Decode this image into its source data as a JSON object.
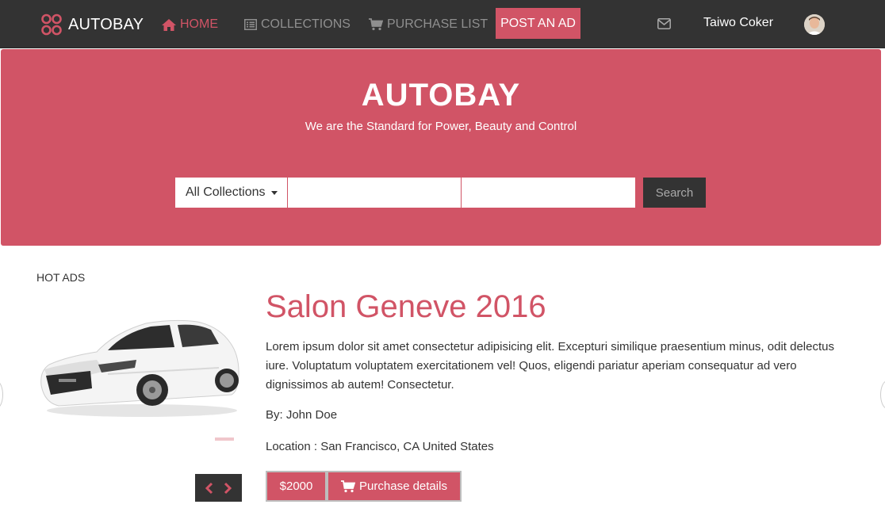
{
  "colors": {
    "accent": "#d15466",
    "dark": "#333333"
  },
  "nav": {
    "brand": "AUTOBAY",
    "items": [
      {
        "label": "HOME",
        "icon": "home-icon",
        "active": true
      },
      {
        "label": "COLLECTIONS",
        "icon": "list-icon",
        "active": false
      },
      {
        "label": "PURCHASE LIST",
        "icon": "cart-icon",
        "active": false
      }
    ],
    "post_ad": "POST AN AD",
    "user_name": "Taiwo Coker"
  },
  "hero": {
    "title": "AUTOBAY",
    "subtitle": "We are the Standard for Power, Beauty and Control",
    "select_value": "All Collections",
    "input1_value": "",
    "input2_value": "",
    "search_label": "Search"
  },
  "hot_ads": {
    "label": "HOT ADS",
    "title": "Salon Geneve 2016",
    "description": "Lorem ipsum dolor sit amet consectetur adipisicing elit. Excepturi similique praesentium minus, odit delectus iure. Voluptatum voluptatem exercitationem vel! Quos, eligendi pariatur aperiam consequatur ad vero dignissimos ab autem! Consectetur.",
    "by": "By: John Doe",
    "location": "Location : San Francisco, CA United States",
    "price": "$2000",
    "details_label": "Purchase details"
  }
}
